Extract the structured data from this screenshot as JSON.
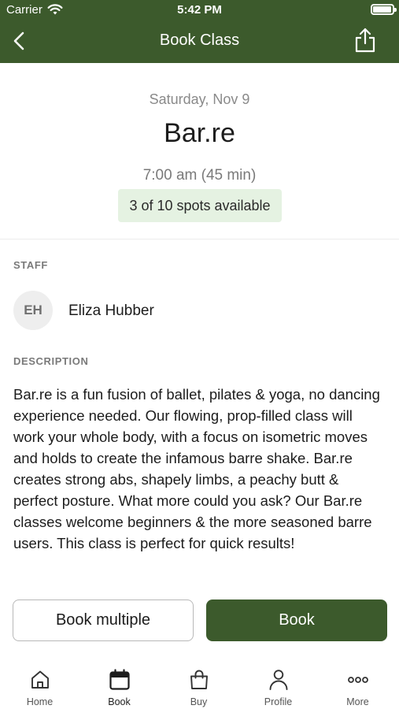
{
  "status_bar": {
    "carrier": "Carrier",
    "time": "5:42 PM",
    "battery_percent": 95
  },
  "nav": {
    "title": "Book Class",
    "back_icon": "chevron-left-icon",
    "share_icon": "share-icon"
  },
  "class": {
    "date": "Saturday, Nov 9",
    "name": "Bar.re",
    "time": "7:00 am (45 min)",
    "spots": "3 of 10 spots available"
  },
  "staff": {
    "label": "STAFF",
    "initials": "EH",
    "name": "Eliza Hubber"
  },
  "description": {
    "label": "DESCRIPTION",
    "text": "Bar.re is a fun fusion of ballet, pilates & yoga, no dancing experience needed. Our flowing, prop-filled class will work your whole body, with a focus on isometric moves and holds to create the infamous barre shake. Bar.re creates strong abs, shapely limbs, a peachy butt & perfect posture. What more could you ask? Our Bar.re classes welcome beginners & the more seasoned barre users. This class is perfect for quick results!"
  },
  "actions": {
    "book_multiple": "Book multiple",
    "book": "Book"
  },
  "tabs": [
    {
      "label": "Home",
      "icon": "home-icon"
    },
    {
      "label": "Book",
      "icon": "calendar-icon",
      "active": true
    },
    {
      "label": "Buy",
      "icon": "shopping-bag-icon"
    },
    {
      "label": "Profile",
      "icon": "person-icon"
    },
    {
      "label": "More",
      "icon": "more-dots-icon"
    }
  ],
  "colors": {
    "brand": "#3c5a2c",
    "spots_badge_bg": "#e5f2e2"
  }
}
